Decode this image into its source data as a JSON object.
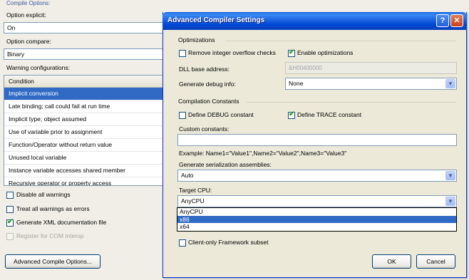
{
  "background_page": {
    "group_heading": "Compile Options:",
    "option_explicit": {
      "label": "Option explicit:",
      "value": "On"
    },
    "option_compare": {
      "label": "Option compare:",
      "value": "Binary"
    },
    "warning_configurations": {
      "label": "Warning configurations:",
      "column_header": "Condition",
      "rows": [
        "Implicit conversion",
        "Late binding; call could fail at run time",
        "Implicit type; object assumed",
        "Use of variable prior to assignment",
        "Function/Operator without return value",
        "Unused local variable",
        "Instance variable accesses shared member",
        "Recursive operator or property access"
      ],
      "selected_row": "Implicit conversion"
    },
    "checkboxes": [
      {
        "label": "Disable all warnings",
        "checked": false,
        "enabled": true
      },
      {
        "label": "Treat all warnings as errors",
        "checked": false,
        "enabled": true
      },
      {
        "label": "Generate XML documentation file",
        "checked": true,
        "enabled": true
      },
      {
        "label": "Register for COM interop",
        "checked": false,
        "enabled": false
      }
    ],
    "advanced_button": "Advanced Compile Options..."
  },
  "dialog": {
    "title": "Advanced Compiler Settings",
    "help_glyph": "?",
    "close_glyph": "✕",
    "optimizations": {
      "heading": "Optimizations",
      "remove_overflow": {
        "label": "Remove integer overflow checks",
        "checked": false
      },
      "enable_optimizations": {
        "label": "Enable optimizations",
        "checked": true
      },
      "dll_base_label": "DLL base address:",
      "dll_base_value": "&H00400000",
      "debug_info_label": "Generate debug info:",
      "debug_info_value": "None"
    },
    "compilation_constants": {
      "heading": "Compilation Constants",
      "define_debug": {
        "label": "Define DEBUG constant",
        "checked": false
      },
      "define_trace": {
        "label": "Define TRACE constant",
        "checked": true
      },
      "custom_label": "Custom constants:",
      "custom_value": "",
      "example_text": "Example: Name1=\"Value1\",Name2=\"Value2\",Name3=\"Value3\""
    },
    "serialization": {
      "label": "Generate serialization assemblies:",
      "value": "Auto"
    },
    "target_cpu": {
      "label": "Target CPU:",
      "value": "AnyCPU",
      "options": [
        "AnyCPU",
        "x86",
        "x64"
      ],
      "highlighted": "x86"
    },
    "client_only": {
      "label": "Client-only Framework subset",
      "checked": false
    },
    "ok_label": "OK",
    "cancel_label": "Cancel"
  },
  "colors": {
    "title_bar": "#0a58e4",
    "selection": "#316ac5",
    "dialog_face": "#ece9d8",
    "check_tick": "#21a121"
  }
}
